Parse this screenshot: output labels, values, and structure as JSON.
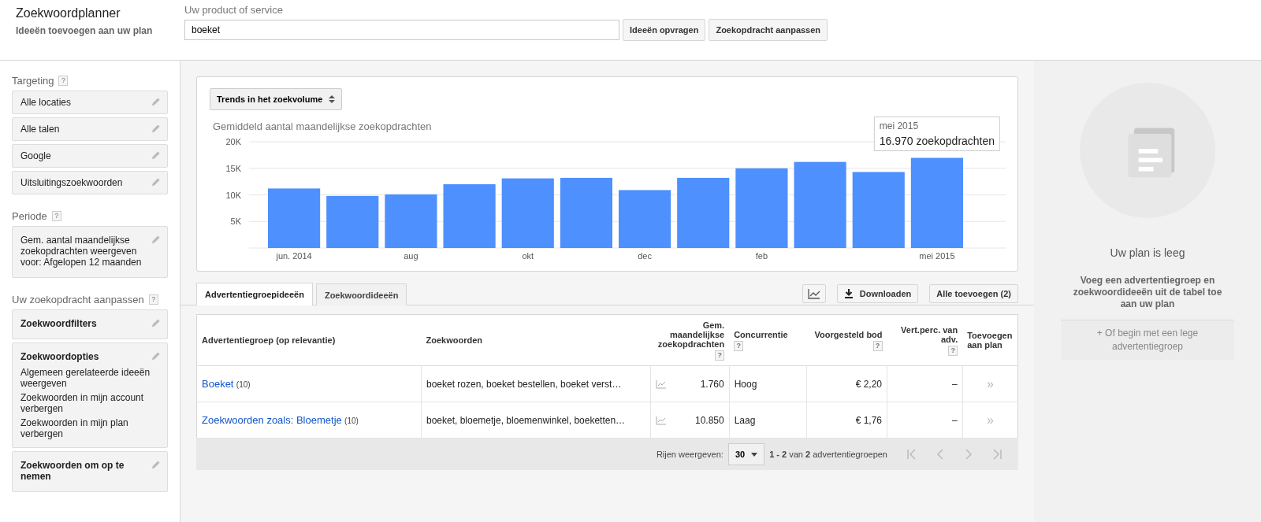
{
  "header": {
    "title": "Zoekwoordplanner",
    "subtitle": "Ideeën toevoegen aan uw plan",
    "product_label": "Uw product of service",
    "product_value": "boeket",
    "buttons": [
      "Ideeën opvragen",
      "Zoekopdracht aanpassen"
    ]
  },
  "sidebar": {
    "sections": [
      {
        "title": "Targeting",
        "help": "?",
        "items": [
          {
            "kind": "plain",
            "lines": [
              "Alle locaties"
            ]
          },
          {
            "kind": "plain",
            "lines": [
              "Alle talen"
            ]
          },
          {
            "kind": "plain",
            "lines": [
              "Google"
            ]
          },
          {
            "kind": "plain",
            "lines": [
              "Uitsluitingszoekwoorden"
            ]
          }
        ]
      },
      {
        "title": "Periode",
        "help": "?",
        "items": [
          {
            "kind": "text",
            "lines": [
              "Gem. aantal maandelijkse zoekopdrachten weergeven voor: Afgelopen 12 maanden"
            ]
          }
        ]
      },
      {
        "title": "Uw zoekopdracht aanpassen",
        "help": "?",
        "items": [
          {
            "kind": "bold",
            "lines": [
              "Zoekwoordfilters"
            ]
          },
          {
            "kind": "bold",
            "lines": [
              "Zoekwoordopties",
              "Algemeen gerelateerde ideeën weergeven",
              "Zoekwoorden in mijn account verbergen",
              "Zoekwoorden in mijn plan verbergen"
            ]
          },
          {
            "kind": "bold",
            "lines": [
              "Zoekwoorden om op te nemen"
            ]
          }
        ]
      }
    ]
  },
  "chart_panel": {
    "selector": "Trends in het zoekvolume",
    "tooltip": {
      "title": "mei 2015",
      "value": "16.970 zoekopdrachten"
    },
    "chart_data": {
      "type": "bar",
      "title": "Gemiddeld aantal maandelijkse zoekopdrachten",
      "categories": [
        "jun. 2014",
        null,
        "aug",
        null,
        "okt",
        null,
        "dec",
        null,
        "feb",
        null,
        null,
        "mei 2015"
      ],
      "grid": true,
      "series": [
        {
          "color": "#4d90fe",
          "values": [
            11200,
            9800,
            10100,
            12000,
            13100,
            13200,
            10900,
            13200,
            15000,
            16200,
            14300,
            16970
          ]
        }
      ],
      "ylim": [
        0,
        20000
      ],
      "yticks": [
        {
          "value": 5000,
          "label": "5K"
        },
        {
          "value": 10000,
          "label": "10K"
        },
        {
          "value": 15000,
          "label": "15K"
        },
        {
          "value": 20000,
          "label": "20K"
        }
      ]
    }
  },
  "tabs": [
    {
      "label": "Advertentiegroepideeën",
      "selected": true
    },
    {
      "label": "Zoekwoordideeën",
      "selected": false
    }
  ],
  "toolbar": {
    "download": "Downloaden",
    "add_all": "Alle toevoegen (2)"
  },
  "table": {
    "columns": [
      {
        "label": "Advertentiegroep (op relevantie)"
      },
      {
        "label": "Zoekwoorden"
      },
      {
        "label": "Gem. maandelijkse zoekopdrachten",
        "help": "?"
      },
      {
        "label": "Concurrentie",
        "help": "?"
      },
      {
        "label": "Voorgesteld bod",
        "help": "?"
      },
      {
        "label": "Vert.perc. van adv.",
        "help": "?"
      },
      {
        "label": "Toevoegen aan plan"
      }
    ],
    "rows": [
      {
        "group": "Boeket",
        "count": "(10)",
        "keywords": "boeket rozen, boeket bestellen, boeket verst…",
        "searches": "1.760",
        "competition": "Hoog",
        "bid": "€ 2,20",
        "share": "–",
        "add": "»"
      },
      {
        "group": "Zoekwoorden zoals: Bloemetje",
        "count": "(10)",
        "keywords": "boeket, bloemetje, bloemenwinkel, boeketten…",
        "searches": "10.850",
        "competition": "Laag",
        "bid": "€ 1,76",
        "share": "–",
        "add": "»"
      }
    ]
  },
  "pagination": {
    "rows_label": "Rijen weergeven:",
    "rows_value": "30",
    "range": "**1 - 2** van **2** advertentiegroepen"
  },
  "plan": {
    "title": "Uw plan is leeg",
    "message": "Voeg een advertentiegroep en zoekwoordideeën uit de tabel toe aan uw plan",
    "link": "+ Of begin met een lege advertentiegroep"
  }
}
